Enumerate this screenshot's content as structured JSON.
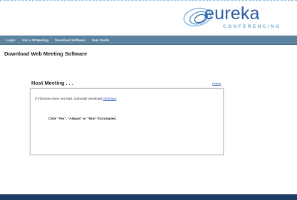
{
  "brand": {
    "name": "eureka",
    "tagline": "CONFERENCING",
    "logo_icon": "swirl-icon",
    "primary_color": "#2a5ea7",
    "accent_color": "#6fa7cf"
  },
  "nav": {
    "items": [
      {
        "label": "Login"
      },
      {
        "label": "Join a W Meeting"
      },
      {
        "label": "Download Software"
      },
      {
        "label": "User Guide"
      }
    ],
    "background": "#5c83a0"
  },
  "page": {
    "heading": "Download Web Meeting Software"
  },
  "section": {
    "title": "Host Meeting . . .",
    "home_link": "Home"
  },
  "panel": {
    "note_prefix": "If Infoshare does not start, manually download ",
    "note_link": "Infoshare",
    "note_suffix": ".",
    "instruction": "Click \"Yes\", \"Always\" or \"Run\" if prompted."
  },
  "footer": {
    "color": "#1d3c63"
  }
}
